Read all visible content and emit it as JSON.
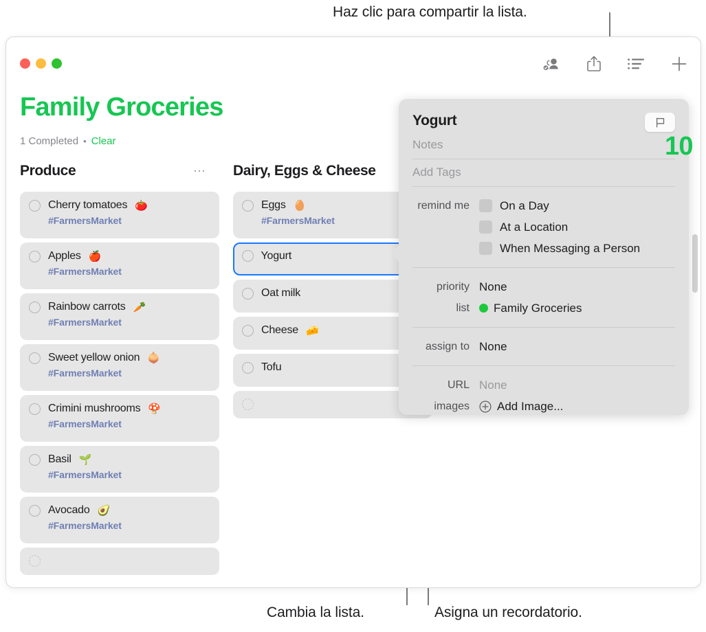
{
  "callouts": {
    "top": "Haz clic para compartir la lista.",
    "bottom_left": "Cambia la lista.",
    "bottom_right": "Asigna un recordatorio."
  },
  "window": {
    "traffic_lights": [
      "close-red",
      "minimize-yellow",
      "zoom-green"
    ],
    "toolbar": [
      {
        "name": "share-people-icon",
        "label": "Shared"
      },
      {
        "name": "share-icon",
        "label": "Share"
      },
      {
        "name": "list-view-icon",
        "label": "View as List"
      },
      {
        "name": "add-icon",
        "label": "Add Reminder"
      }
    ]
  },
  "list": {
    "title": "Family Groceries",
    "completed_text": "1 Completed",
    "separator": "•",
    "clear_label": "Clear",
    "accent_color": "#17c653",
    "behind_text": "10"
  },
  "columns": [
    {
      "heading": "Produce",
      "more_label": "…",
      "items": [
        {
          "label": "Cherry tomatoes",
          "emoji": "🍅",
          "tag": "#FarmersMarket",
          "selected": false
        },
        {
          "label": "Apples",
          "emoji": "🍎",
          "tag": "#FarmersMarket",
          "selected": false
        },
        {
          "label": "Rainbow carrots",
          "emoji": "🥕",
          "tag": "#FarmersMarket",
          "selected": false
        },
        {
          "label": "Sweet yellow onion",
          "emoji": "🧅",
          "tag": "#FarmersMarket",
          "selected": false
        },
        {
          "label": "Crimini mushrooms",
          "emoji": "🍄",
          "tag": "#FarmersMarket",
          "selected": false
        },
        {
          "label": "Basil",
          "emoji": "🌱",
          "tag": "#FarmersMarket",
          "selected": false
        },
        {
          "label": "Avocado",
          "emoji": "🥑",
          "tag": "#FarmersMarket",
          "selected": false
        },
        {
          "label": "",
          "emoji": "",
          "tag": "",
          "selected": false,
          "empty": true
        }
      ]
    },
    {
      "heading": "Dairy, Eggs & Cheese",
      "more_label": "…",
      "items": [
        {
          "label": "Eggs",
          "emoji": "🥚",
          "tag": "#FarmersMarket",
          "selected": false
        },
        {
          "label": "Yogurt",
          "emoji": "",
          "tag": "",
          "selected": true,
          "info_icon": "info-circle-icon"
        },
        {
          "label": "Oat milk",
          "emoji": "",
          "tag": "",
          "selected": false
        },
        {
          "label": "Cheese",
          "emoji": "🧀",
          "tag": "",
          "selected": false
        },
        {
          "label": "Tofu",
          "emoji": "",
          "tag": "",
          "selected": false
        },
        {
          "label": "",
          "emoji": "",
          "tag": "",
          "selected": false,
          "empty": true
        }
      ]
    }
  ],
  "popover": {
    "title": "Yogurt",
    "flag_icon": "flag-icon",
    "notes_placeholder": "Notes",
    "tags_placeholder": "Add Tags",
    "remind_me_label": "remind me",
    "remind_options": [
      {
        "label": "On a Day",
        "checked": false
      },
      {
        "label": "At a Location",
        "checked": false
      },
      {
        "label": "When Messaging a Person",
        "checked": false
      }
    ],
    "priority_label": "priority",
    "priority_value": "None",
    "list_label": "list",
    "list_value": "Family Groceries",
    "list_color": "#1ec83c",
    "assign_label": "assign to",
    "assign_value": "None",
    "url_label": "URL",
    "url_value": "None",
    "images_label": "images",
    "images_value": "Add Image..."
  }
}
